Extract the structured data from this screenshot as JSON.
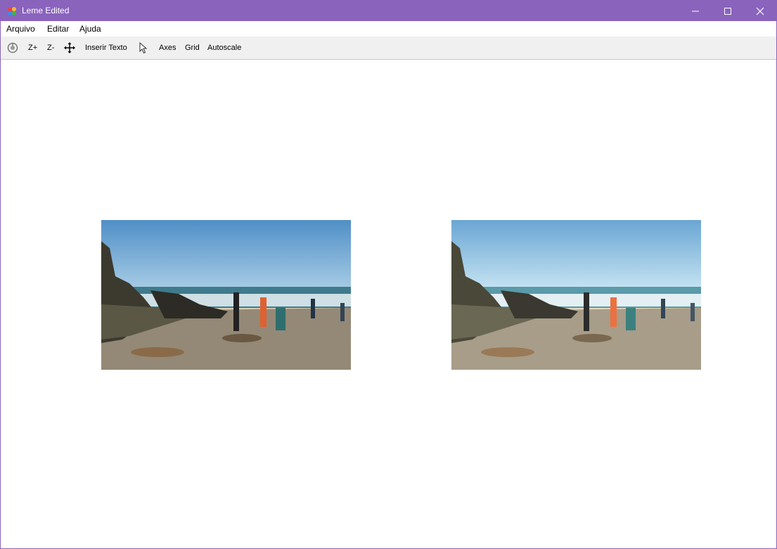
{
  "window": {
    "title": "Leme Edited"
  },
  "menu": [
    "Arquivo",
    "Editar",
    "Ajuda"
  ],
  "toolbar": {
    "home_icon": "home-icon",
    "zoom_in": "Z+",
    "zoom_out": "Z-",
    "pan_icon": "move-icon",
    "insert_text": "Inserir Texto",
    "pointer_icon": "pointer-icon",
    "axes": "Axes",
    "grid": "Grid",
    "autoscale": "Autoscale"
  },
  "images": [
    {
      "name": "original-photo",
      "tone": "original"
    },
    {
      "name": "edited-photo",
      "tone": "edited"
    }
  ]
}
